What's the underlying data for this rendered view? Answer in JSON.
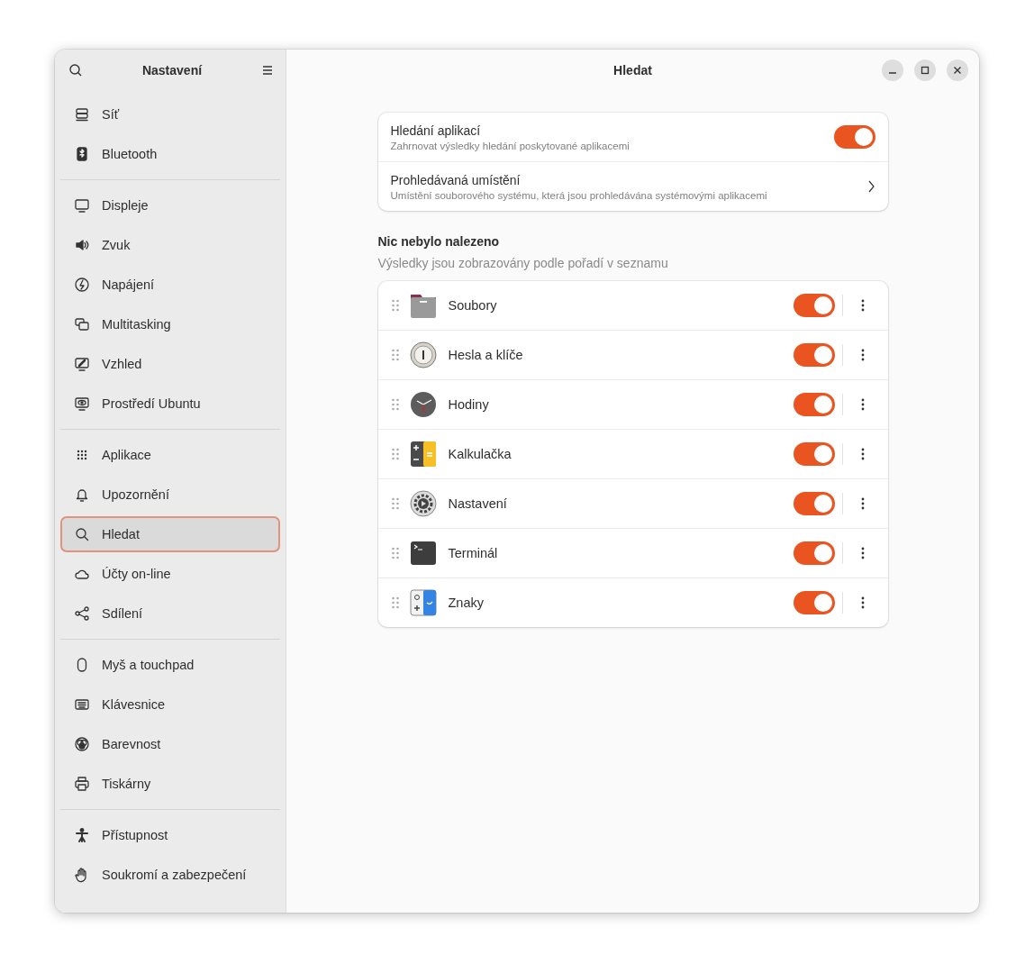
{
  "sidebar": {
    "title": "Nastavení",
    "groups": [
      [
        {
          "label": "Síť",
          "selected": false
        },
        {
          "label": "Bluetooth",
          "selected": false
        }
      ],
      [
        {
          "label": "Displeje",
          "selected": false
        },
        {
          "label": "Zvuk",
          "selected": false
        },
        {
          "label": "Napájení",
          "selected": false
        },
        {
          "label": "Multitasking",
          "selected": false
        },
        {
          "label": "Vzhled",
          "selected": false
        },
        {
          "label": "Prostředí Ubuntu",
          "selected": false
        }
      ],
      [
        {
          "label": "Aplikace",
          "selected": false
        },
        {
          "label": "Upozornění",
          "selected": false
        },
        {
          "label": "Hledat",
          "selected": true
        },
        {
          "label": "Účty on-line",
          "selected": false
        },
        {
          "label": "Sdílení",
          "selected": false
        }
      ],
      [
        {
          "label": "Myš a touchpad",
          "selected": false
        },
        {
          "label": "Klávesnice",
          "selected": false
        },
        {
          "label": "Barevnost",
          "selected": false
        },
        {
          "label": "Tiskárny",
          "selected": false
        }
      ],
      [
        {
          "label": "Přístupnost",
          "selected": false
        },
        {
          "label": "Soukromí a zabezpečení",
          "selected": false
        }
      ]
    ]
  },
  "title": "Hledat",
  "settings": [
    {
      "kind": "switch",
      "title": "Hledání aplikací",
      "subtitle": "Zahrnovat výsledky hledání poskytované aplikacemi",
      "on": true
    },
    {
      "kind": "link",
      "title": "Prohledávaná umístění",
      "subtitle": "Umístění souborového systému, která jsou prohledávána systémovými aplikacemi"
    }
  ],
  "results": {
    "heading": "Nic nebylo nalezeno",
    "description": "Výsledky jsou zobrazovány podle pořadí v seznamu",
    "apps": [
      {
        "name": "Soubory",
        "on": true
      },
      {
        "name": "Hesla a klíče",
        "on": true
      },
      {
        "name": "Hodiny",
        "on": true
      },
      {
        "name": "Kalkulačka",
        "on": true
      },
      {
        "name": "Nastavení",
        "on": true
      },
      {
        "name": "Terminál",
        "on": true
      },
      {
        "name": "Znaky",
        "on": true
      }
    ]
  }
}
